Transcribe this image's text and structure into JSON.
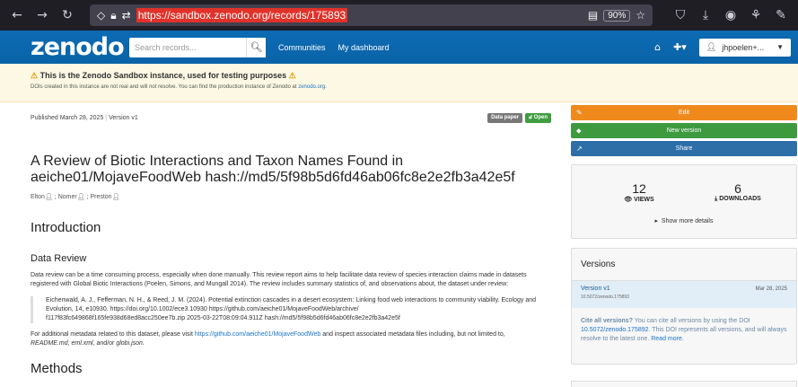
{
  "browser": {
    "url": "https://sandbox.zenodo.org/records/175893",
    "zoom": "90%"
  },
  "nav": {
    "logo": "zenodo",
    "search_placeholder": "Search records...",
    "links": [
      "Communities",
      "My dashboard"
    ],
    "user": "jhpoelen+..."
  },
  "banner": {
    "title": "This is the Zenodo Sandbox instance, used for testing purposes",
    "text": "DOIs created in this instance are not real and will not resolve. You can find the production instance of Zenodo at",
    "link": "zenodo.org"
  },
  "record": {
    "published": "Published March 28, 2025",
    "version": "Version v1",
    "badge_type": "Data paper",
    "badge_access": "Open",
    "title": "A Review of Biotic Interactions and Taxon Names Found in aeiche01/MojaveFoodWeb hash://md5/5f98b5d6fd46ab06fc8e2e2fb3a42e5f",
    "creators": [
      "Elton",
      "Nomer",
      "Preston"
    ],
    "intro_heading": "Introduction",
    "review_heading": "Data Review",
    "review_text": "Data review can be a time consuming process, especially when done manually. This review report aims to help facilitate data review of species interaction claims made in datasets registered with Global Biotic Interactions (Poelen, Simons, and Mungall 2014). The review includes summary statistics of, and observations about, the dataset under review:",
    "citation_1": "Eichenwald, A. J., Fefferman, N. H., & Reed, J. M. (2024). Potential extinction cascades in a desert ecosystem: Linking food web interactions to community viability. Ecology and Evolution, 14, e10930. https://doi.org/10.1002/ece3.10930 https://github.com/aeiche01/MojaveFoodWeb/archive/",
    "citation_2": "f117f83fc649868f165fe938d68ed8acc250ee7b.zip 2025-03-22T08:09:04.911Z hash://md5/5f98b5d6fd46ab06fc8e2e2fb3a42e5f",
    "meta_text_1": "For additional metadata related to this dataset, please visit",
    "meta_link": "https://github.com/aeiche01/MojaveFoodWeb",
    "meta_text_2": "and inspect associated metadata files including, but not limited to,",
    "meta_files": "README.md, eml.xml,",
    "meta_and": "and/or",
    "meta_last": "globi.json.",
    "methods_heading": "Methods"
  },
  "sidebar": {
    "edit": "Edit",
    "new_version": "New version",
    "share": "Share",
    "views_count": "12",
    "views_label": "VIEWS",
    "downloads_count": "6",
    "downloads_label": "DOWNLOADS",
    "show_more": "Show more details",
    "versions_heading": "Versions",
    "version_name": "Version v1",
    "version_date": "Mar 28, 2025",
    "version_doi": "10.5072/zenodo.175893",
    "cite_bold": "Cite all versions?",
    "cite_text_1": "You can cite all versions by using the DOI",
    "cite_doi": "10.5072/zenodo.175892",
    "cite_text_2": ". This DOI represents all versions, and will always resolve to the latest one.",
    "read_more": "Read more."
  }
}
